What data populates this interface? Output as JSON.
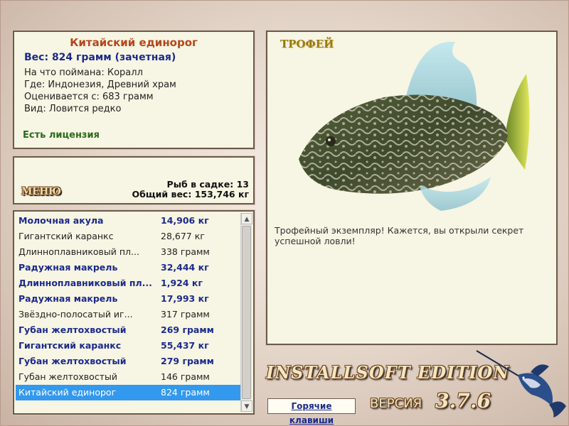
{
  "fish_info": {
    "title": "Китайский единорог",
    "weight": "Вес: 824 грамм (зачетная)",
    "caught_with": "На что поймана: Коралл",
    "location": "Где: Индонезия, Древний храм",
    "valued_from": "Оценивается с: 683 грамм",
    "rarity": "Вид: Ловится редко",
    "license": "Есть лицензия"
  },
  "menu": {
    "button_label": "МЕНЮ",
    "fish_in_keepnet": "Рыб в садке: 13",
    "total_weight": "Общий вес: 153,746 кг"
  },
  "catch_list": [
    {
      "name": "Молочная акула",
      "weight": "14,906 кг",
      "style": "bold"
    },
    {
      "name": "Гигантский каранкс",
      "weight": "28,677 кг",
      "style": "plain"
    },
    {
      "name": "Длинноплавниковый пл...",
      "weight": "338 грамм",
      "style": "plain"
    },
    {
      "name": "Радужная макрель",
      "weight": "32,444 кг",
      "style": "bold"
    },
    {
      "name": "Длинноплавниковый пл...",
      "weight": "1,924 кг",
      "style": "bold"
    },
    {
      "name": "Радужная макрель",
      "weight": "17,993 кг",
      "style": "bold"
    },
    {
      "name": "Звёздно-полосатый иг...",
      "weight": "317 грамм",
      "style": "plain"
    },
    {
      "name": "Губан желтохвостый",
      "weight": "269 грамм",
      "style": "bold"
    },
    {
      "name": "Гигантский каранкс",
      "weight": "55,437 кг",
      "style": "bold"
    },
    {
      "name": "Губан желтохвостый",
      "weight": "279 грамм",
      "style": "bold"
    },
    {
      "name": "Губан желтохвостый",
      "weight": "146 грамм",
      "style": "plain"
    },
    {
      "name": "Китайский единорог",
      "weight": "824 грамм",
      "style": "sel"
    }
  ],
  "scrollbar": {
    "up_icon": "triangle-up",
    "down_icon": "triangle-down"
  },
  "trophy": {
    "label": "ТРОФЕЙ",
    "description": "Трофейный экземпляр! Кажется, вы открыли секрет успешной ловли!",
    "image_icon": "filefish-image"
  },
  "branding": {
    "edition": "INSTALLSOFT EDITION",
    "version_label": "ВЕРСИЯ",
    "version_number": "3.7.6",
    "logo_icon": "marlin-logo"
  },
  "hotkeys_label": "Горячие клавиши",
  "colors": {
    "panel_bg": "#f7f5e3",
    "panel_border": "#6d5a4a",
    "title_color": "#b5471b",
    "bold_row_color": "#1b2a8c",
    "license_color": "#2a6b1a",
    "selection_bg": "#3399ee",
    "trophy_label_color": "#9a7a16"
  }
}
